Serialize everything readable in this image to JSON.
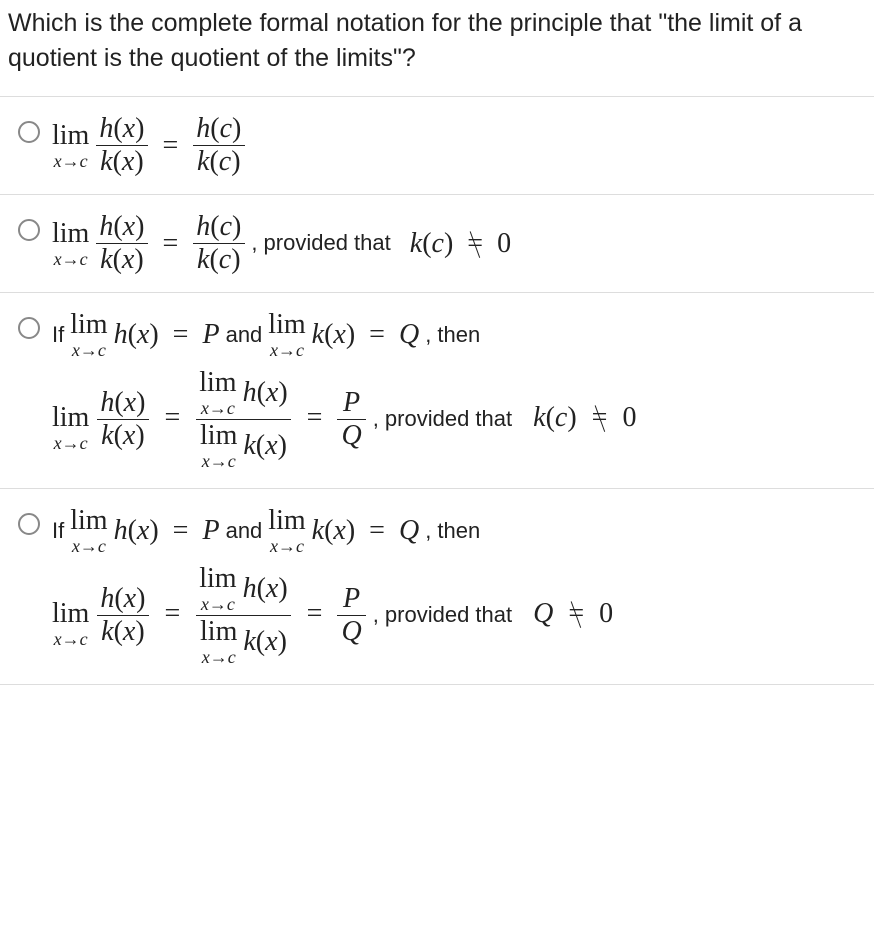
{
  "question": "Which is the complete formal notation for the principle that \"the limit of a quotient is the quotient of the limits\"?",
  "sym": {
    "h": "h",
    "k": "k",
    "x": "x",
    "c": "c",
    "P": "P",
    "Q": "Q",
    "lim": "lim",
    "arrow": "→",
    "eq": "=",
    "zero": "0",
    "lp": "(",
    "rp": ")",
    "comma": ","
  },
  "txt": {
    "if": "If",
    "and": "and",
    "then": ", then",
    "provided": ", provided that"
  }
}
